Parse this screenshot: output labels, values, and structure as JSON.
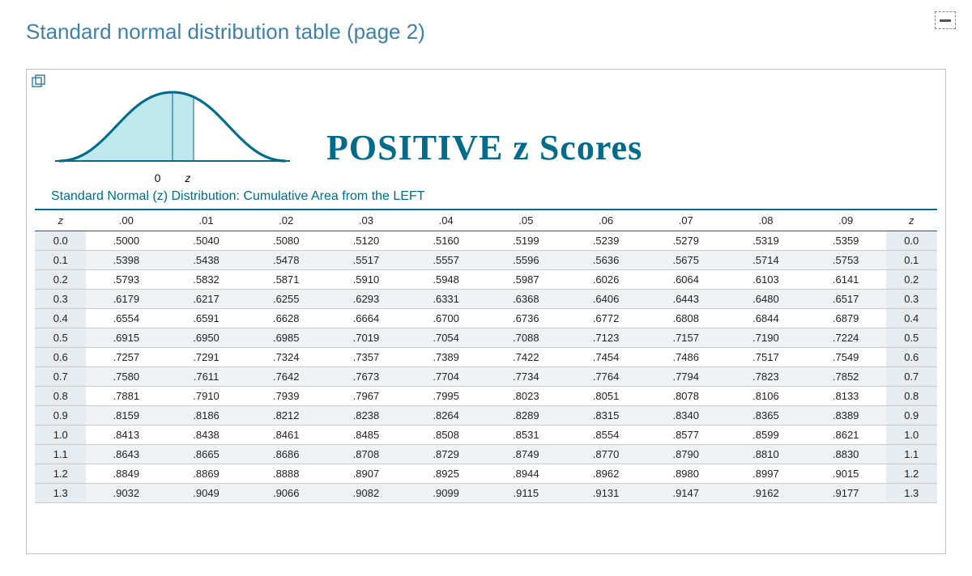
{
  "page_title": "Standard normal distribution table (page 2)",
  "curve": {
    "zero_label": "0",
    "z_label": "z"
  },
  "heading": "POSITIVE z Scores",
  "subtitle": "Standard Normal (z) Distribution: Cumulative Area from the LEFT",
  "columns": [
    "z",
    ".00",
    ".01",
    ".02",
    ".03",
    ".04",
    ".05",
    ".06",
    ".07",
    ".08",
    ".09",
    "z"
  ],
  "rows": [
    {
      "z": "0.0",
      "vals": [
        ".5000",
        ".5040",
        ".5080",
        ".5120",
        ".5160",
        ".5199",
        ".5239",
        ".5279",
        ".5319",
        ".5359"
      ]
    },
    {
      "z": "0.1",
      "vals": [
        ".5398",
        ".5438",
        ".5478",
        ".5517",
        ".5557",
        ".5596",
        ".5636",
        ".5675",
        ".5714",
        ".5753"
      ]
    },
    {
      "z": "0.2",
      "vals": [
        ".5793",
        ".5832",
        ".5871",
        ".5910",
        ".5948",
        ".5987",
        ".6026",
        ".6064",
        ".6103",
        ".6141"
      ]
    },
    {
      "z": "0.3",
      "vals": [
        ".6179",
        ".6217",
        ".6255",
        ".6293",
        ".6331",
        ".6368",
        ".6406",
        ".6443",
        ".6480",
        ".6517"
      ]
    },
    {
      "z": "0.4",
      "vals": [
        ".6554",
        ".6591",
        ".6628",
        ".6664",
        ".6700",
        ".6736",
        ".6772",
        ".6808",
        ".6844",
        ".6879"
      ]
    },
    {
      "z": "0.5",
      "vals": [
        ".6915",
        ".6950",
        ".6985",
        ".7019",
        ".7054",
        ".7088",
        ".7123",
        ".7157",
        ".7190",
        ".7224"
      ]
    },
    {
      "z": "0.6",
      "vals": [
        ".7257",
        ".7291",
        ".7324",
        ".7357",
        ".7389",
        ".7422",
        ".7454",
        ".7486",
        ".7517",
        ".7549"
      ]
    },
    {
      "z": "0.7",
      "vals": [
        ".7580",
        ".7611",
        ".7642",
        ".7673",
        ".7704",
        ".7734",
        ".7764",
        ".7794",
        ".7823",
        ".7852"
      ]
    },
    {
      "z": "0.8",
      "vals": [
        ".7881",
        ".7910",
        ".7939",
        ".7967",
        ".7995",
        ".8023",
        ".8051",
        ".8078",
        ".8106",
        ".8133"
      ]
    },
    {
      "z": "0.9",
      "vals": [
        ".8159",
        ".8186",
        ".8212",
        ".8238",
        ".8264",
        ".8289",
        ".8315",
        ".8340",
        ".8365",
        ".8389"
      ]
    },
    {
      "z": "1.0",
      "vals": [
        ".8413",
        ".8438",
        ".8461",
        ".8485",
        ".8508",
        ".8531",
        ".8554",
        ".8577",
        ".8599",
        ".8621"
      ]
    },
    {
      "z": "1.1",
      "vals": [
        ".8643",
        ".8665",
        ".8686",
        ".8708",
        ".8729",
        ".8749",
        ".8770",
        ".8790",
        ".8810",
        ".8830"
      ]
    },
    {
      "z": "1.2",
      "vals": [
        ".8849",
        ".8869",
        ".8888",
        ".8907",
        ".8925",
        ".8944",
        ".8962",
        ".8980",
        ".8997",
        ".9015"
      ]
    },
    {
      "z": "1.3",
      "vals": [
        ".9032",
        ".9049",
        ".9066",
        ".9082",
        ".9099",
        ".9115",
        ".9131",
        ".9147",
        ".9162",
        ".9177"
      ]
    }
  ]
}
